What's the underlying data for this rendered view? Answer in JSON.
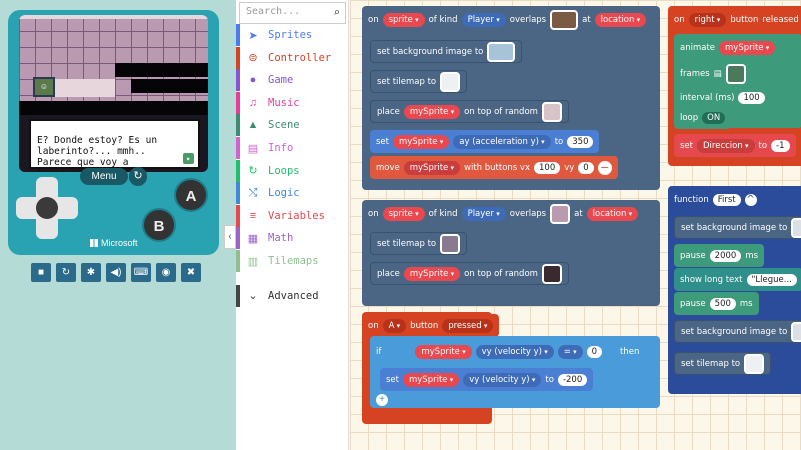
{
  "simulator": {
    "dialog_text": "E? Donde estoy? Es un\nlaberinto?... mmh..\nParece que voy a\ntener que saltar un",
    "menu_label": "Menu",
    "button_a": "A",
    "button_b": "B",
    "brand": "Microsoft",
    "toolbar_icons": [
      "stop-icon",
      "restart-icon",
      "debug-icon",
      "sound-icon",
      "keyboard-icon",
      "screenshot-icon",
      "fullscreen-icon"
    ],
    "toolbar_glyphs": [
      "■",
      "↻",
      "✱",
      "◀)",
      "⌨",
      "◉",
      "✖"
    ]
  },
  "toolbox": {
    "search_placeholder": "Search...",
    "categories": [
      {
        "label": "Sprites",
        "color": "#4b7bec",
        "icon": "➤"
      },
      {
        "label": "Controller",
        "color": "#d54322",
        "icon": "⊜"
      },
      {
        "label": "Game",
        "color": "#8854d0",
        "icon": "●"
      },
      {
        "label": "Music",
        "color": "#e63c9c",
        "icon": "♫"
      },
      {
        "label": "Scene",
        "color": "#3d8b72",
        "icon": "▲"
      },
      {
        "label": "Info",
        "color": "#cf63cf",
        "icon": "▤"
      },
      {
        "label": "Loops",
        "color": "#20bf6b",
        "icon": "↻"
      },
      {
        "label": "Logic",
        "color": "#3c8ad8",
        "icon": "⤭"
      },
      {
        "label": "Variables",
        "color": "#e5484d",
        "icon": "≡"
      },
      {
        "label": "Math",
        "color": "#9c62c9",
        "icon": "▦"
      },
      {
        "label": "Tilemaps",
        "color": "#8fbf8f",
        "icon": "▥"
      },
      {
        "label": "Advanced",
        "color": "#444444",
        "icon": "⌄"
      }
    ]
  },
  "blocks": {
    "overlap1": {
      "on": "on",
      "sprite": "sprite",
      "of_kind": "of kind",
      "kind": "Player",
      "overlaps": "overlaps",
      "at": "at",
      "location": "location"
    },
    "set_bg": "set background image to",
    "set_tilemap": "set tilemap to",
    "place": {
      "place": "place",
      "sprite": "mySprite",
      "on_top": "on top of random"
    },
    "set_accel": {
      "set": "set",
      "sprite": "mySprite",
      "prop": "ay (acceleration y)",
      "to": "to",
      "value": "350"
    },
    "move": {
      "move": "move",
      "sprite": "mySprite",
      "with": "with buttons vx",
      "vx": "100",
      "vy_label": "vy",
      "vy": "0"
    },
    "overlap2": {
      "on": "on",
      "sprite": "sprite",
      "of_kind": "of kind",
      "kind": "Player",
      "overlaps": "overlaps",
      "at": "at",
      "location": "location"
    },
    "set_tilemap2": "set tilemap to",
    "place2": {
      "place": "place",
      "sprite": "mySprite",
      "on_top": "on top of random"
    },
    "on_a": {
      "on": "on",
      "button": "A",
      "button_label": "button",
      "event": "pressed"
    },
    "if_block": {
      "if": "if",
      "sprite": "mySprite",
      "prop": "vy (velocity y)",
      "op": "=",
      "value": "0",
      "then": "then"
    },
    "set_vy": {
      "set": "set",
      "sprite": "mySprite",
      "prop": "vy (velocity y)",
      "to": "to",
      "value": "-200"
    },
    "on_right": {
      "on": "on",
      "button": "right",
      "label": "button",
      "event": "released"
    },
    "animate": {
      "animate": "animate",
      "sprite": "mySprite"
    },
    "frames": "frames",
    "interval": {
      "label": "interval (ms)",
      "value": "100"
    },
    "loop": {
      "label": "loop",
      "value": "ON"
    },
    "set_dir": {
      "set": "set",
      "var": "Direccion",
      "to": "to",
      "value": "-1"
    },
    "function": {
      "label": "function",
      "name": "First"
    },
    "fn_set_bg": "set background image to",
    "pause1": {
      "label": "pause",
      "value": "2000",
      "unit": "ms"
    },
    "show_text": {
      "label": "show long text",
      "value": "\"Llegue..."
    },
    "pause2": {
      "label": "pause",
      "value": "500",
      "unit": "ms"
    },
    "fn_set_bg2": "set background image to",
    "fn_set_tilemap": "set tilemap to"
  }
}
